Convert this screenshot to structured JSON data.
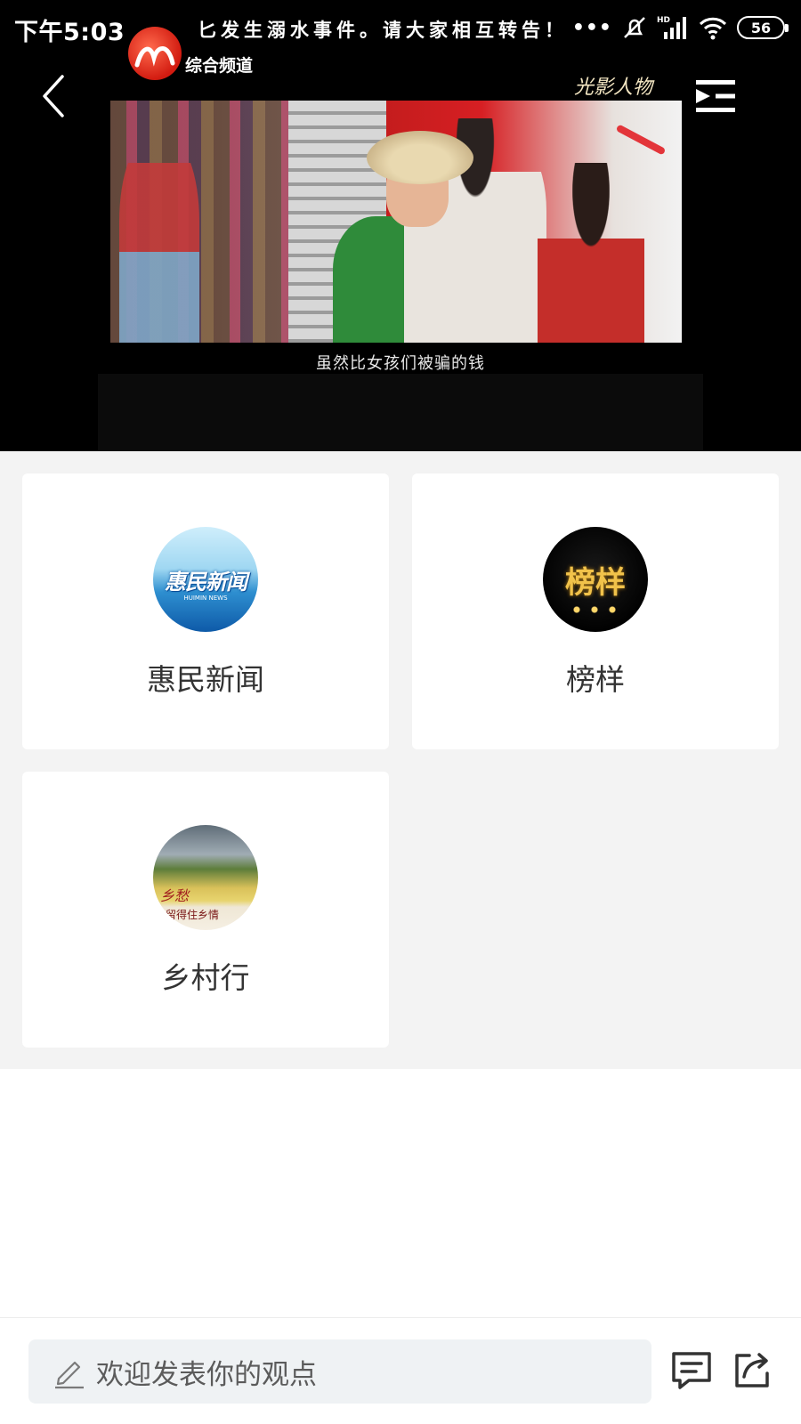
{
  "status_bar": {
    "time": "下午5:03",
    "dots": "•••",
    "battery": "56",
    "icons": [
      "alarm-off-icon",
      "hd-signal-icon",
      "wifi-icon",
      "battery-icon"
    ]
  },
  "player": {
    "ticker_text": "匕发生溺水事件。请大家相互转告！",
    "channel_name": "综合频道",
    "watermark": "光影人物",
    "subtitle": "虽然比女孩们被骗的钱",
    "colors": {
      "background": "#000000",
      "channel_logo": "#d21b10"
    }
  },
  "programs": [
    {
      "title": "惠民新闻",
      "avatar_text": "惠民新闻",
      "avatar_sub": "HUIMIN NEWS"
    },
    {
      "title": "榜样",
      "avatar_text": "榜样"
    },
    {
      "title": "乡村行",
      "avatar_text": "乡愁",
      "avatar_sub": "留得住乡情"
    }
  ],
  "comment_bar": {
    "placeholder": "欢迎发表你的观点",
    "icons": [
      "pencil-icon",
      "comment-icon",
      "share-icon"
    ]
  }
}
